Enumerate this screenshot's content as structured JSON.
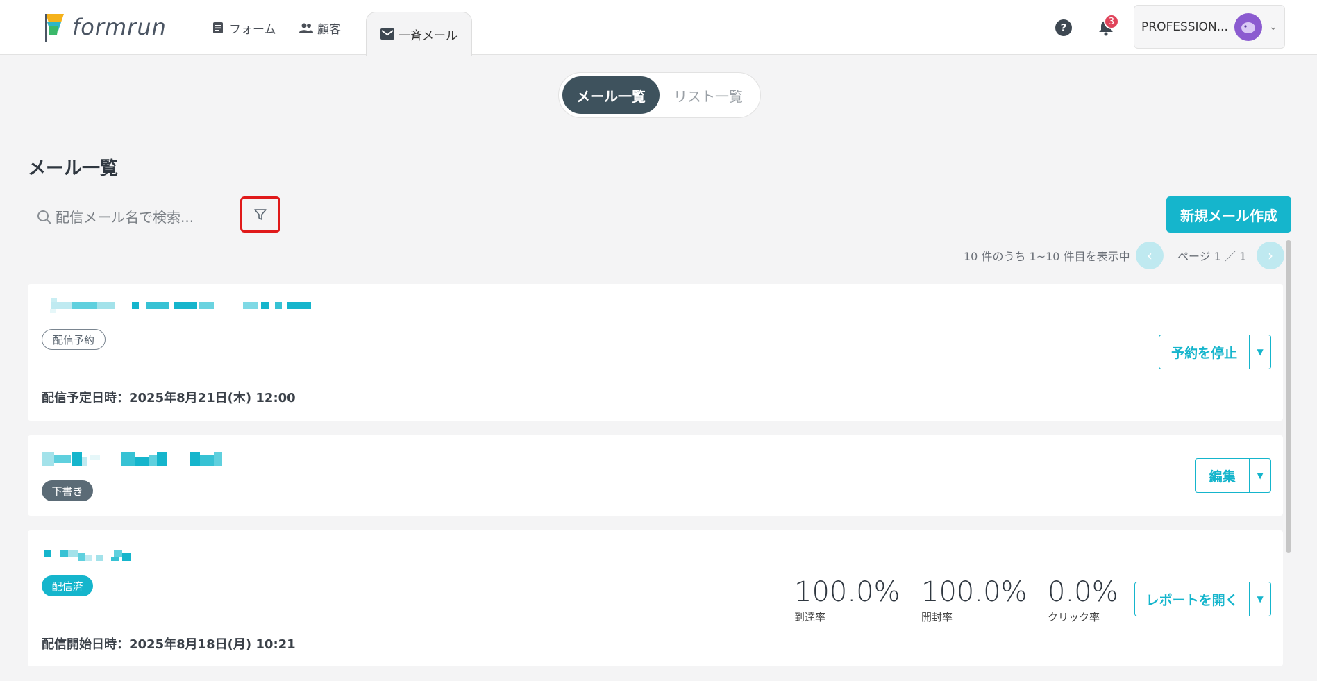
{
  "header": {
    "logo_text": "formrun",
    "nav": [
      {
        "label": "フォーム",
        "icon": "form-icon"
      },
      {
        "label": "顧客",
        "icon": "people-icon"
      },
      {
        "label": "一斉メール",
        "icon": "mail-icon"
      }
    ],
    "help_label": "?",
    "notification_count": "3",
    "account_name": "PROFESSION..."
  },
  "toggle": {
    "left": "メール一覧",
    "right": "リスト一覧"
  },
  "page_title": "メール一覧",
  "search": {
    "placeholder": "配信メール名で検索..."
  },
  "new_mail_label": "新規メール作成",
  "pager": {
    "summary": "10 件のうち 1~10 件目を表示中",
    "page": "ページ 1 ／ 1"
  },
  "mails": [
    {
      "status": "配信予約",
      "meta": "配信予定日時：2025年8月21日(木) 12:00",
      "action": "予約を停止"
    },
    {
      "status": "下書き",
      "action": "編集"
    },
    {
      "status": "配信済",
      "meta": "配信開始日時：2025年8月18日(月) 10:21",
      "action": "レポートを開く",
      "stats": [
        {
          "value": "100.0%",
          "label": "到達率"
        },
        {
          "value": "100.0%",
          "label": "開封率"
        },
        {
          "value": "0.0%",
          "label": "クリック率"
        }
      ]
    }
  ],
  "colors": {
    "accent": "#15b5cc",
    "dark": "#3e525d",
    "badge": "#e0435a",
    "highlight": "#e01a1a"
  }
}
